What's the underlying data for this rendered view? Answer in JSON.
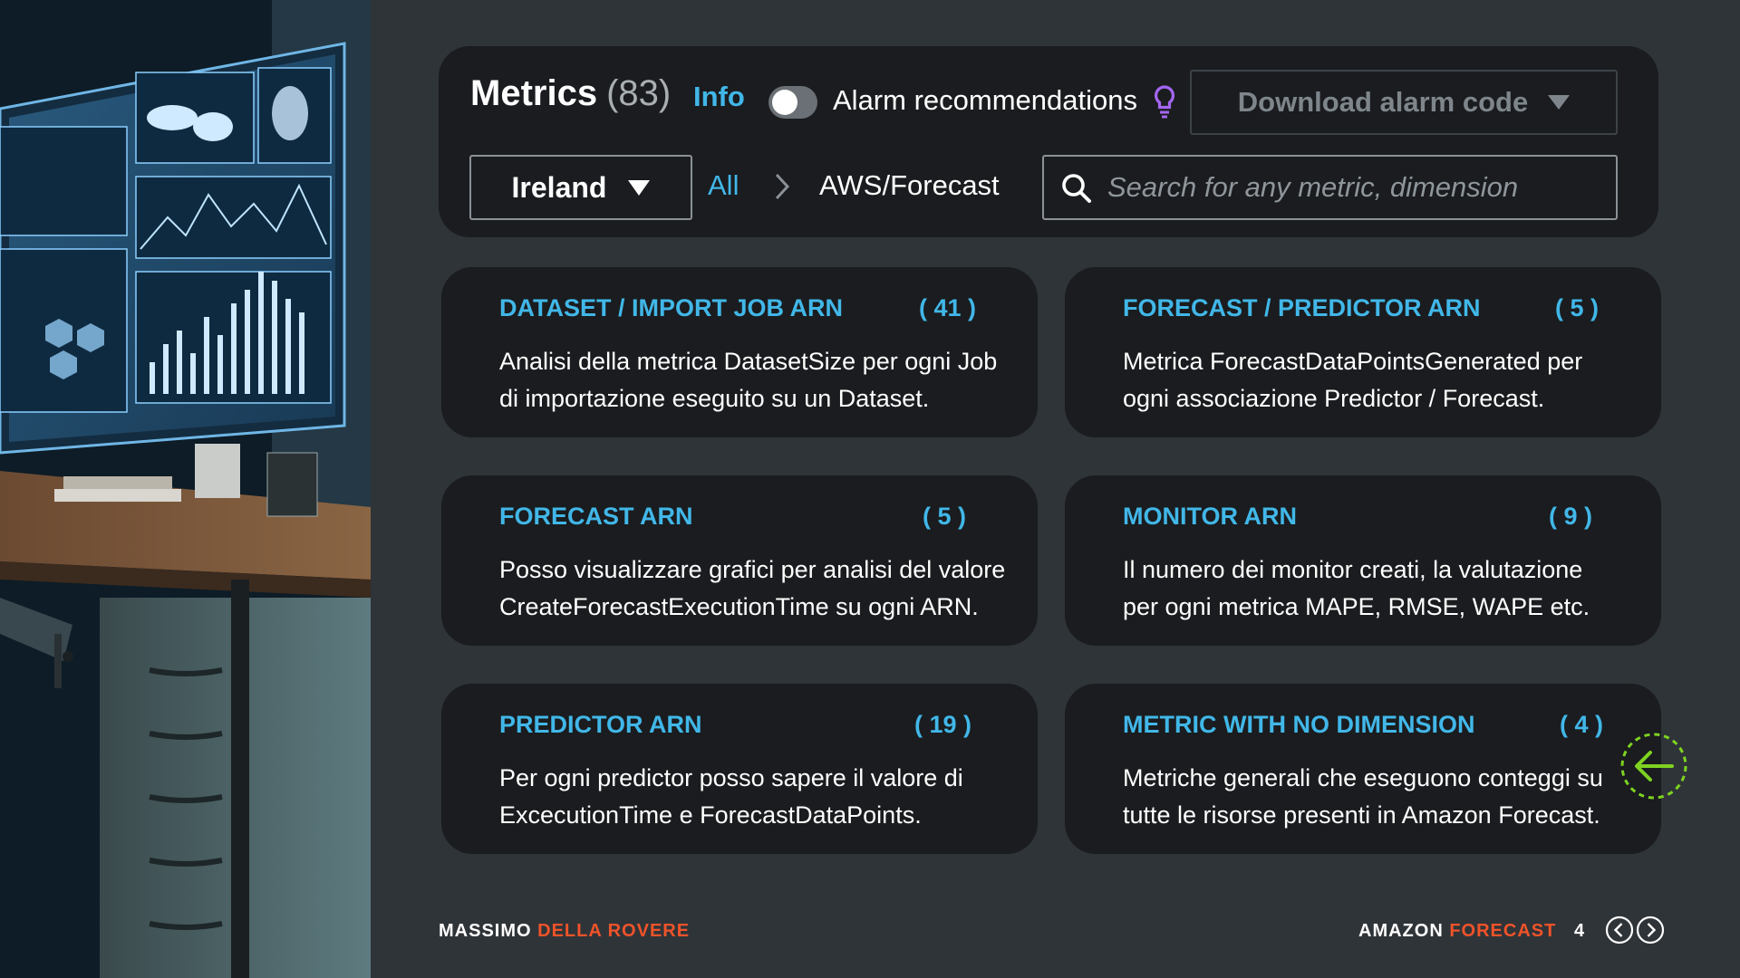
{
  "header": {
    "title": "Metrics",
    "count": "(83)",
    "info_link": "Info",
    "alarm_toggle_label": "Alarm recommendations",
    "download_button": "Download alarm code",
    "region": "Ireland",
    "breadcrumb": {
      "all": "All",
      "current": "AWS/Forecast"
    },
    "search": {
      "placeholder": "Search for any metric, dimension",
      "value": ""
    }
  },
  "cards": [
    {
      "title": "DATASET / IMPORT JOB ARN",
      "count": "( 41 )",
      "desc_line1": "Analisi della metrica DatasetSize per ogni Job",
      "desc_line2": "di importazione eseguito su un Dataset."
    },
    {
      "title": "FORECAST / PREDICTOR ARN",
      "count": "( 5 )",
      "desc_line1": "Metrica ForecastDataPointsGenerated per",
      "desc_line2": "ogni associazione Predictor / Forecast."
    },
    {
      "title": "FORECAST ARN",
      "count": "( 5 )",
      "desc_line1": "Posso visualizzare grafici per analisi del valore",
      "desc_line2": "CreateForecastExecutionTime su ogni ARN."
    },
    {
      "title": "MONITOR ARN",
      "count": "( 9 )",
      "desc_line1": "Il numero dei monitor creati, la valutazione",
      "desc_line2": "per ogni metrica MAPE, RMSE, WAPE etc."
    },
    {
      "title": "PREDICTOR ARN",
      "count": "( 19 )",
      "desc_line1": "Per ogni predictor posso sapere il valore di",
      "desc_line2": "ExcecutionTime e ForecastDataPoints."
    },
    {
      "title": "METRIC WITH NO DIMENSION",
      "count": "( 4 )",
      "desc_line1": "Metriche generali che eseguono conteggi su",
      "desc_line2": "tutte le risorse presenti in Amazon Forecast."
    }
  ],
  "footer": {
    "author_first": "MASSIMO",
    "author_last": "DELLA ROVERE",
    "product_part1": "AMAZON",
    "product_part2": "FORECAST",
    "page_number": "4"
  },
  "colors": {
    "background": "#2f3438",
    "panel": "#1a1c1f",
    "accent_link": "#41b7e8",
    "accent_orange": "#f0532a",
    "nav_green": "#7ed321",
    "bulb_purple": "#a366f0"
  },
  "icons": {
    "search": "search-icon",
    "bulb": "lightbulb-icon",
    "breadcrumb_separator": "chevron-right-icon",
    "back": "arrow-left-icon",
    "prev": "chevron-left-icon",
    "next": "chevron-right-icon"
  }
}
